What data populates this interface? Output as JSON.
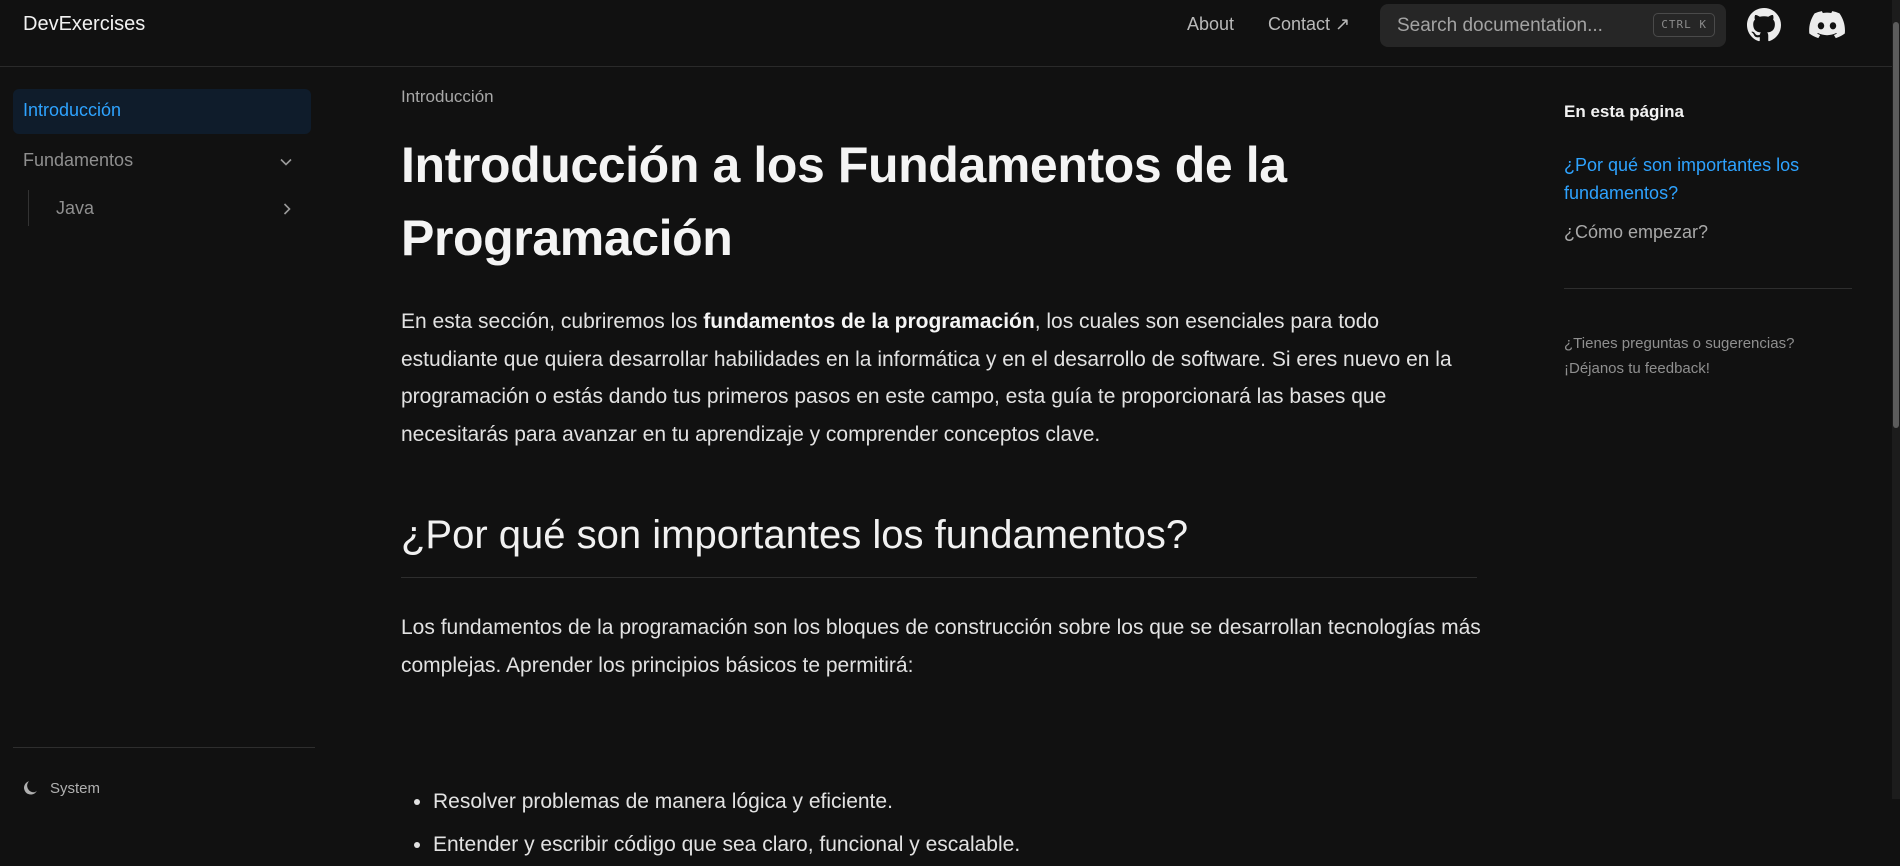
{
  "header": {
    "brand": "DevExercises",
    "nav": {
      "about": "About",
      "contact": "Contact ↗"
    },
    "search": {
      "placeholder": "Search documentation...",
      "shortcut": "CTRL K"
    },
    "icons": {
      "github": "github-icon",
      "discord": "discord-icon"
    }
  },
  "sidebar": {
    "items": [
      {
        "label": "Introducción",
        "active": true
      },
      {
        "label": "Fundamentos",
        "expanded": true,
        "children": [
          {
            "label": "Java"
          }
        ]
      }
    ],
    "theme_label": "System"
  },
  "main": {
    "breadcrumb": "Introducción",
    "title": "Introducción a los Fundamentos de la Programación",
    "intro": {
      "before": "En esta sección, cubriremos los ",
      "bold": "fundamentos de la programación",
      "after": ", los cuales son esenciales para todo estudiante que quiera desarrollar habilidades en la informática y en el desarrollo de software. Si eres nuevo en la programación o estás dando tus primeros pasos en este campo, esta guía te proporcionará las bases que necesitarás para avanzar en tu aprendizaje y comprender conceptos clave."
    },
    "section_heading": "¿Por qué son importantes los fundamentos?",
    "section_paragraph": "Los fundamentos de la programación son los bloques de construcción sobre los que se desarrollan tecnologías más complejas. Aprender los principios básicos te permitirá:",
    "bullets": [
      "Resolver problemas de manera lógica y eficiente.",
      "Entender y escribir código que sea claro, funcional y escalable."
    ]
  },
  "toc": {
    "title": "En esta página",
    "links": [
      "¿Por qué son importantes los fundamentos?",
      "¿Cómo empezar?"
    ],
    "feedback": "¿Tienes preguntas o sugerencias? ¡Déjanos tu feedback!"
  },
  "colors": {
    "background": "#111111",
    "accent": "#2ea3ff",
    "active_bg": "#0f1c2b"
  }
}
